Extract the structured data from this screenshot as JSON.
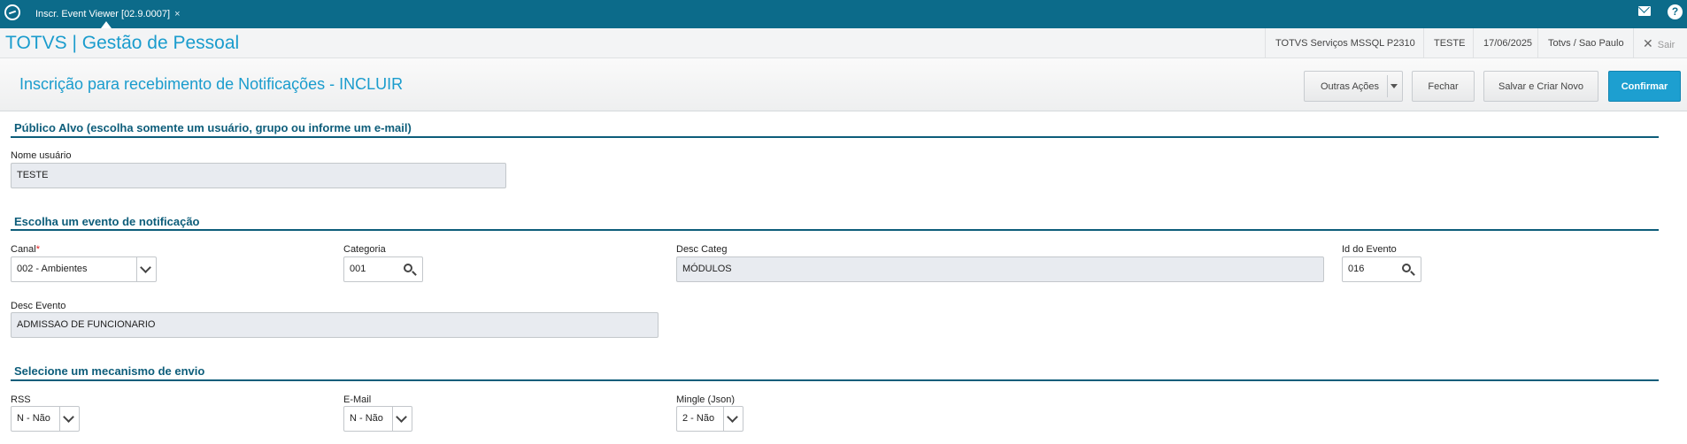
{
  "topbar": {
    "tab_label": "Inscr. Event Viewer [02.9.0007]",
    "tab_close": "×",
    "help": "?"
  },
  "header": {
    "app_title": "TOTVS | Gestão de Pessoal",
    "environment": "TOTVS Serviços MSSQL P2310",
    "user": "TESTE",
    "date": "17/06/2025",
    "location": "Totvs / Sao Paulo",
    "logout_x": "✕",
    "logout_label": "Sair"
  },
  "page": {
    "title": "Inscrição para recebimento de Notificações - INCLUIR",
    "actions": {
      "more": "Outras Ações",
      "close": "Fechar",
      "save_new": "Salvar e Criar Novo",
      "confirm": "Confirmar"
    }
  },
  "sections": {
    "target": {
      "title": "Público Alvo (escolha somente um usuário, grupo ou informe um e-mail)",
      "user_label": "Nome usuário",
      "user_value": "TESTE"
    },
    "event": {
      "title": "Escolha um evento de notificação",
      "canal_label": "Canal",
      "required_mark": "*",
      "canal_value": "002 - Ambientes",
      "categoria_label": "Categoria",
      "categoria_value": "001",
      "desc_categ_label": "Desc Categ",
      "desc_categ_value": "MÓDULOS",
      "id_evento_label": "Id do Evento",
      "id_evento_value": "016",
      "desc_evento_label": "Desc Evento",
      "desc_evento_value": "ADMISSAO DE FUNCIONARIO"
    },
    "mechanism": {
      "title": "Selecione um mecanismo de envio",
      "rss_label": "RSS",
      "rss_value": "N - Não",
      "email_label": "E-Mail",
      "email_value": "N - Não",
      "mingle_label": "Mingle (Json)",
      "mingle_value": "2 - Não"
    }
  },
  "colors": {
    "topbar": "#0c6b8a",
    "brand": "#1a9ccd",
    "section": "#0d5d7a",
    "primary_button": "#1d9fd0"
  }
}
